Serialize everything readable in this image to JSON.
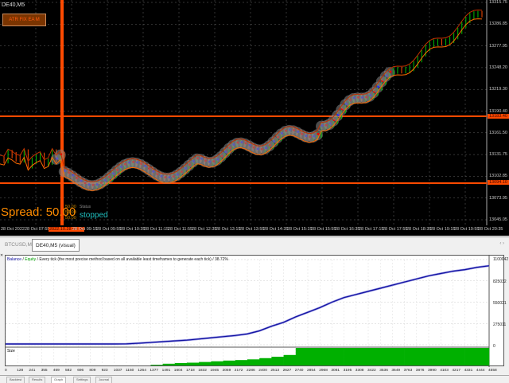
{
  "chart": {
    "symbol": "DE40,M5",
    "badge": "ATR FIX EA M",
    "price_labels": [
      "13315.75",
      "13286.85",
      "13277.95",
      "13248.20",
      "13219.30",
      "13190.40",
      "13161.50",
      "13131.75",
      "13102.85",
      "13073.95",
      "13045.05"
    ],
    "hline_upper": "13183.40",
    "hline_lower": "13094.10",
    "spread": "Spread: 50.00",
    "mini_values": [
      "50.00",
      "50.00",
      "50.00"
    ],
    "status_label": "Status",
    "status_value": "stopped",
    "time_labels": [
      "28 Oct 2022",
      "28 Oct 07:55",
      "2022.10.28 08:00",
      "28 Oct 09:15",
      "28 Oct 09:55",
      "28 Oct 10:35",
      "28 Oct 11:15",
      "28 Oct 11:55",
      "28 Oct 12:35",
      "28 Oct 13:15",
      "28 Oct 13:55",
      "28 Oct 14:35",
      "28 Oct 15:15",
      "28 Oct 15:55",
      "28 Oct 16:35",
      "28 Oct 17:15",
      "28 Oct 17:55",
      "28 Oct 18:35",
      "28 Oct 19:15",
      "28 Oct 19:55",
      "28 Oct 20:35"
    ],
    "colors": {
      "hline": "#ff4a00",
      "bull": "#00c000",
      "bear": "#ff4a00",
      "ma": "#ff6a00"
    }
  },
  "tabs": [
    "BTCUSD,M1",
    "DE40,M5 (visual)"
  ],
  "tabs_arrows": "‹ ›",
  "graph": {
    "balance_label": "Balance",
    "sep1": " / ",
    "equity_label": "Equity",
    "desc": " / Every tick (the most precise method based on all available least timeframes to generate each tick) / 38.72%",
    "y_labels": [
      "1100042",
      "825032",
      "550021",
      "275011",
      "0"
    ],
    "size_label": "Size",
    "x_labels": [
      "0",
      "128",
      "241",
      "355",
      "469",
      "582",
      "696",
      "809",
      "923",
      "1037",
      "1150",
      "1264",
      "1377",
      "1491",
      "1604",
      "1718",
      "1832",
      "1945",
      "2059",
      "2172",
      "2286",
      "2400",
      "2513",
      "2627",
      "2740",
      "2854",
      "2968",
      "3081",
      "3195",
      "3308",
      "3422",
      "3536",
      "3649",
      "3763",
      "3876",
      "3990",
      "4103",
      "4217",
      "4331",
      "4444",
      "4558"
    ],
    "balance": [
      10000,
      10000,
      10000,
      10000,
      10000,
      10000,
      10000,
      10000,
      10000,
      10000,
      12000,
      20000,
      30000,
      40000,
      50000,
      60000,
      75000,
      90000,
      105000,
      120000,
      140000,
      180000,
      240000,
      290000,
      360000,
      420000,
      480000,
      550000,
      610000,
      650000,
      690000,
      730000,
      770000,
      810000,
      850000,
      890000,
      920000,
      950000,
      970000,
      1000000,
      1020000
    ],
    "size": [
      0,
      0,
      0,
      0,
      0,
      0,
      0,
      0,
      0,
      0,
      0,
      0,
      0.04,
      0.1,
      0.14,
      0.16,
      0.2,
      0.24,
      0.28,
      0.31,
      0.35,
      0.42,
      0.5,
      0.6,
      1,
      1,
      1,
      1,
      1,
      1,
      1,
      1,
      1,
      1,
      1,
      1,
      1,
      1,
      1,
      1,
      1
    ],
    "colors": {
      "balance": "#1010a0",
      "equity": "#00a000",
      "size": "#00b000"
    }
  },
  "bottom_tabs": [
    "Backtest",
    "Results",
    "Graph",
    "Settings",
    "Journal"
  ]
}
